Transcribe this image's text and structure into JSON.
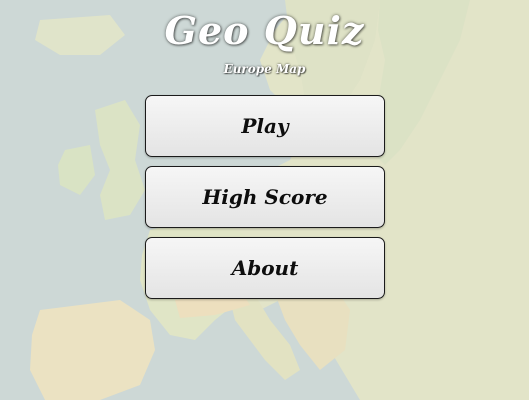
{
  "header": {
    "title": "Geo Quiz",
    "subtitle": "Europe Map"
  },
  "menu": {
    "play_label": "Play",
    "high_score_label": "High Score",
    "about_label": "About"
  },
  "background": {
    "icon": "europe-map-background",
    "sea_color": "#b9c9c6",
    "land_color": "#d9dcb6",
    "lowland_color": "#c9d7ad",
    "highland_color": "#e6d6ad"
  }
}
